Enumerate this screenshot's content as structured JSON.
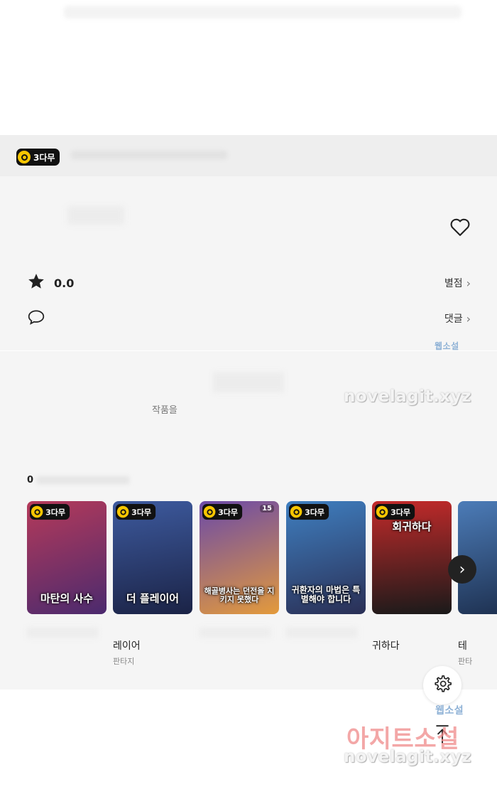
{
  "badge_label": "3다무",
  "rating": {
    "value": "0.0",
    "link_label": "별점"
  },
  "comments": {
    "link_label": "댓글"
  },
  "description": {
    "label": "작품을"
  },
  "recommendations": {
    "count": "0",
    "items": [
      {
        "cover_title": "마탄의 사수",
        "name": "",
        "genre": "",
        "cover_colors": [
          "#b53a5a",
          "#4b2a6e"
        ]
      },
      {
        "cover_title": "더 플레이어",
        "name": "레이어",
        "genre": "판타지",
        "cover_colors": [
          "#3d5a9e",
          "#1b2346"
        ]
      },
      {
        "cover_title": "해골병사는 던전을 지키지 못했다",
        "name": "",
        "genre": "",
        "badge_number": "15",
        "cover_colors": [
          "#6b4aa8",
          "#e39a3c"
        ]
      },
      {
        "cover_title": "귀환자의 마법은 특별해야 합니다",
        "name": "",
        "genre": "",
        "cover_colors": [
          "#3f7fc0",
          "#2a2f55"
        ]
      },
      {
        "cover_title": "회귀하다",
        "name": "귀하다",
        "genre": "",
        "cover_colors": [
          "#c22a2a",
          "#1a1a1a"
        ]
      },
      {
        "cover_title": "",
        "name": "테",
        "genre": "판타",
        "cover_colors": [
          "#4c7cb8",
          "#1b2c4a"
        ]
      }
    ]
  },
  "watermarks": {
    "site": "novelagit.xyz",
    "small_top": "웹소설",
    "big": "아지트소설",
    "small_bottom": "웹소설"
  },
  "colors": {
    "badge_bg": "#111111",
    "clock_yellow": "#f7c600",
    "section_bg": "#f5f5f5"
  },
  "icons": [
    "heart-icon",
    "star-icon",
    "comment-icon",
    "chevron-right-icon",
    "settings-icon",
    "arrow-up-icon"
  ]
}
